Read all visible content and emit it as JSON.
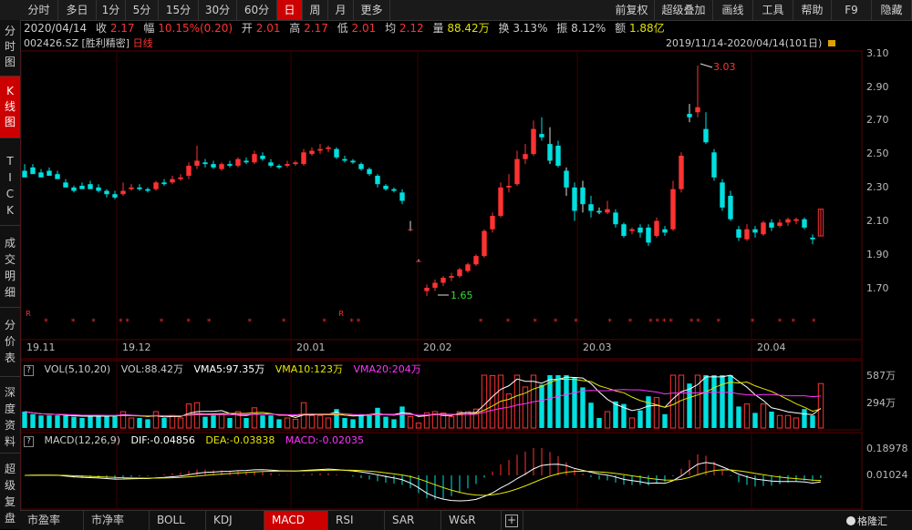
{
  "toolbar": {
    "periods": [
      "分时",
      "多日",
      "1分",
      "5分",
      "15分",
      "30分",
      "60分",
      "日",
      "周",
      "月",
      "更多"
    ],
    "active_period": "日",
    "right_buttons": [
      "前复权",
      "超级叠加",
      "画线",
      "工具",
      "帮助",
      "F9",
      "隐藏"
    ]
  },
  "sidebar": {
    "items": [
      "分时图",
      "K线图",
      "TICK",
      "成交明细",
      "分价表",
      "深度资料",
      "超级复盘"
    ],
    "active": "K线图"
  },
  "info": {
    "date": "2020/04/14",
    "close_label": "收",
    "close": "2.17",
    "range_label": "幅",
    "range": "10.15%(0.20)",
    "open_label": "开",
    "open": "2.01",
    "high_label": "高",
    "high": "2.17",
    "low_label": "低",
    "low": "2.01",
    "avg_label": "均",
    "avg": "2.12",
    "vol_label": "量",
    "vol": "88.42万",
    "turnover_label": "换",
    "turnover": "3.13%",
    "amp_label": "振",
    "amp": "8.12%",
    "amount_label": "额",
    "amount": "1.88亿"
  },
  "stock": {
    "code": "002426.SZ",
    "name": "[胜利精密]",
    "period": "日线",
    "date_range": "2019/11/14-2020/04/14(101日)"
  },
  "colors": {
    "up": "#ff3232",
    "down": "#00e0e0",
    "ma5": "#ffffff",
    "ma10": "#e6e600",
    "ma20": "#ff33ff"
  },
  "chart_data": {
    "type": "candlestick",
    "price_axis": [
      "3.10",
      "2.90",
      "2.70",
      "2.50",
      "2.30",
      "2.10",
      "1.90",
      "1.70"
    ],
    "ylim": [
      1.58,
      3.14
    ],
    "date_ticks": [
      "19.11",
      "19.12",
      "20.01",
      "20.02",
      "20.03",
      "20.04"
    ],
    "annotations": {
      "high": "3.03",
      "low": "1.65"
    },
    "candles": [
      [
        2.4,
        2.44,
        2.38,
        2.36
      ],
      [
        2.42,
        2.44,
        2.4,
        2.38
      ],
      [
        2.39,
        2.41,
        2.37,
        2.36
      ],
      [
        2.4,
        2.42,
        2.38,
        2.37
      ],
      [
        2.38,
        2.4,
        2.36,
        2.35
      ],
      [
        2.33,
        2.35,
        2.31,
        2.3
      ],
      [
        2.3,
        2.31,
        2.27,
        2.28
      ],
      [
        2.31,
        2.33,
        2.3,
        2.29
      ],
      [
        2.32,
        2.34,
        2.3,
        2.29
      ],
      [
        2.3,
        2.32,
        2.27,
        2.28
      ],
      [
        2.28,
        2.29,
        2.24,
        2.26
      ],
      [
        2.26,
        2.28,
        2.23,
        2.24
      ],
      [
        2.26,
        2.33,
        2.25,
        2.28
      ],
      [
        2.29,
        2.32,
        2.28,
        2.3
      ],
      [
        2.3,
        2.32,
        2.28,
        2.29
      ],
      [
        2.29,
        2.3,
        2.27,
        2.28
      ],
      [
        2.29,
        2.34,
        2.28,
        2.33
      ],
      [
        2.33,
        2.35,
        2.31,
        2.32
      ],
      [
        2.33,
        2.37,
        2.32,
        2.35
      ],
      [
        2.35,
        2.38,
        2.34,
        2.36
      ],
      [
        2.37,
        2.45,
        2.35,
        2.43
      ],
      [
        2.43,
        2.55,
        2.41,
        2.46
      ],
      [
        2.45,
        2.47,
        2.42,
        2.44
      ],
      [
        2.44,
        2.46,
        2.41,
        2.42
      ],
      [
        2.41,
        2.45,
        2.4,
        2.44
      ],
      [
        2.44,
        2.46,
        2.42,
        2.43
      ],
      [
        2.43,
        2.48,
        2.42,
        2.47
      ],
      [
        2.46,
        2.48,
        2.44,
        2.45
      ],
      [
        2.45,
        2.52,
        2.44,
        2.5
      ],
      [
        2.49,
        2.51,
        2.46,
        2.47
      ],
      [
        2.45,
        2.47,
        2.42,
        2.43
      ],
      [
        2.43,
        2.44,
        2.41,
        2.42
      ],
      [
        2.43,
        2.46,
        2.42,
        2.44
      ],
      [
        2.44,
        2.46,
        2.43,
        2.45
      ],
      [
        2.44,
        2.53,
        2.43,
        2.51
      ],
      [
        2.5,
        2.54,
        2.49,
        2.52
      ],
      [
        2.52,
        2.56,
        2.5,
        2.53
      ],
      [
        2.53,
        2.55,
        2.51,
        2.54
      ],
      [
        2.53,
        2.54,
        2.47,
        2.48
      ],
      [
        2.47,
        2.49,
        2.45,
        2.46
      ],
      [
        2.46,
        2.47,
        2.44,
        2.45
      ],
      [
        2.44,
        2.45,
        2.4,
        2.41
      ],
      [
        2.41,
        2.42,
        2.37,
        2.38
      ],
      [
        2.37,
        2.38,
        2.3,
        2.32
      ],
      [
        2.31,
        2.32,
        2.28,
        2.29
      ],
      [
        2.29,
        2.3,
        2.27,
        2.28
      ],
      [
        2.27,
        2.29,
        2.2,
        2.22
      ],
      [
        2.05,
        2.1,
        2.04,
        2.05
      ],
      [
        1.86,
        1.87,
        1.86,
        1.86
      ],
      [
        1.68,
        1.72,
        1.65,
        1.7
      ],
      [
        1.7,
        1.75,
        1.68,
        1.73
      ],
      [
        1.73,
        1.77,
        1.71,
        1.76
      ],
      [
        1.76,
        1.79,
        1.74,
        1.77
      ],
      [
        1.77,
        1.82,
        1.76,
        1.81
      ],
      [
        1.8,
        1.85,
        1.79,
        1.84
      ],
      [
        1.84,
        1.9,
        1.83,
        1.89
      ],
      [
        1.89,
        2.05,
        1.88,
        2.04
      ],
      [
        2.05,
        2.15,
        2.03,
        2.13
      ],
      [
        2.13,
        2.33,
        2.12,
        2.3
      ],
      [
        2.3,
        2.38,
        2.27,
        2.31
      ],
      [
        2.32,
        2.52,
        2.31,
        2.47
      ],
      [
        2.47,
        2.56,
        2.44,
        2.5
      ],
      [
        2.5,
        2.7,
        2.49,
        2.65
      ],
      [
        2.62,
        2.72,
        2.58,
        2.6
      ],
      [
        2.56,
        2.66,
        2.44,
        2.46
      ],
      [
        2.55,
        2.58,
        2.42,
        2.43
      ],
      [
        2.4,
        2.42,
        2.25,
        2.3
      ],
      [
        2.3,
        2.33,
        2.1,
        2.16
      ],
      [
        2.3,
        2.34,
        2.15,
        2.2
      ],
      [
        2.2,
        2.25,
        2.12,
        2.16
      ],
      [
        2.16,
        2.18,
        2.14,
        2.15
      ],
      [
        2.15,
        2.22,
        2.14,
        2.17
      ],
      [
        2.15,
        2.17,
        2.06,
        2.08
      ],
      [
        2.08,
        2.09,
        2.0,
        2.01
      ],
      [
        2.04,
        2.06,
        2.02,
        2.05
      ],
      [
        2.06,
        2.08,
        2.0,
        2.03
      ],
      [
        2.06,
        2.08,
        1.95,
        1.97
      ],
      [
        2.01,
        2.12,
        2.0,
        2.1
      ],
      [
        2.05,
        2.07,
        2.01,
        2.03
      ],
      [
        2.05,
        2.34,
        2.04,
        2.29
      ],
      [
        2.29,
        2.51,
        2.27,
        2.49
      ],
      [
        2.74,
        2.8,
        2.69,
        2.72
      ],
      [
        2.75,
        3.03,
        2.72,
        2.78
      ],
      [
        2.65,
        2.75,
        2.56,
        2.57
      ],
      [
        2.51,
        2.53,
        2.34,
        2.36
      ],
      [
        2.33,
        2.35,
        2.16,
        2.18
      ],
      [
        2.25,
        2.28,
        2.1,
        2.11
      ],
      [
        2.05,
        2.07,
        1.98,
        2.0
      ],
      [
        1.99,
        2.08,
        1.98,
        2.05
      ],
      [
        2.05,
        2.07,
        2.0,
        2.03
      ],
      [
        2.02,
        2.1,
        2.01,
        2.09
      ],
      [
        2.09,
        2.11,
        2.04,
        2.06
      ],
      [
        2.07,
        2.11,
        2.06,
        2.09
      ],
      [
        2.09,
        2.12,
        2.07,
        2.11
      ],
      [
        2.1,
        2.12,
        2.08,
        2.11
      ],
      [
        2.11,
        2.12,
        2.05,
        2.06
      ],
      [
        2.0,
        2.02,
        1.96,
        1.99
      ],
      [
        2.01,
        2.17,
        2.01,
        2.17
      ]
    ],
    "r_markers": [
      0,
      39
    ],
    "star_markers": [
      3,
      7,
      10,
      14,
      15,
      20,
      24,
      27,
      33,
      38,
      44,
      48,
      49,
      67,
      71,
      75,
      78,
      81,
      86,
      89,
      92,
      93,
      94,
      95,
      98,
      99,
      102,
      107,
      111,
      113,
      116
    ],
    "volume": {
      "label": "VOL(5,10,20)",
      "vol": "VOL:88.42万",
      "vma5": "VMA5:97.35万",
      "vma10": "VMA10:123万",
      "vma20": "VMA20:204万",
      "axis": [
        "587万",
        "294万"
      ],
      "max": 600
    },
    "macd": {
      "label": "MACD(12,26,9)",
      "dif": "DIF:-0.04856",
      "dea": "DEA:-0.03838",
      "macd": "MACD:-0.02035",
      "axis": [
        "0.18978",
        "0.01024"
      ]
    }
  },
  "bottom_tabs": [
    "市盈率",
    "市净率",
    "BOLL",
    "KDJ",
    "MACD",
    "RSI",
    "SAR",
    "W&R"
  ],
  "active_tab": "MACD",
  "watermark": "格隆汇"
}
